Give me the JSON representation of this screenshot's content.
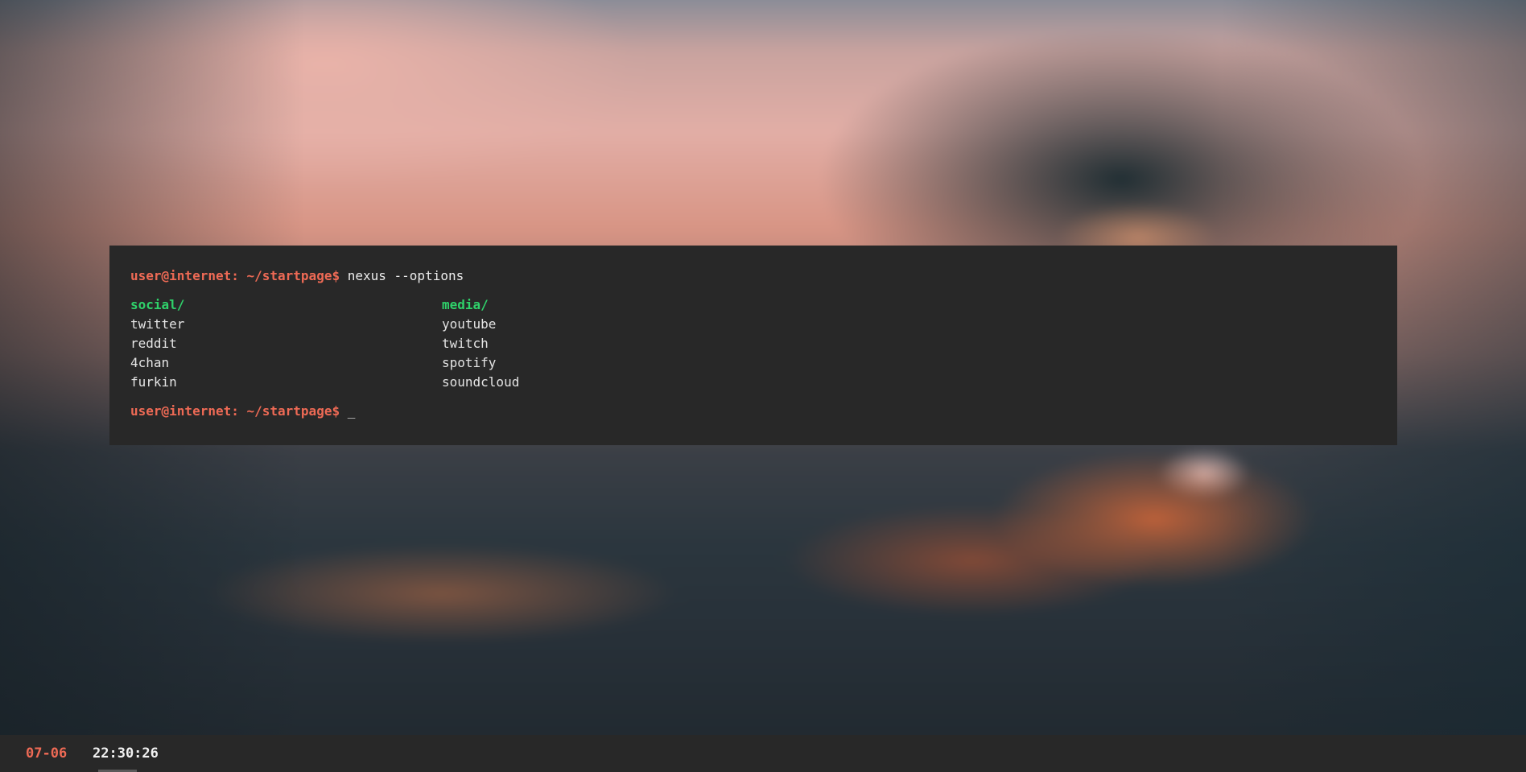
{
  "background": {
    "description_colors": {
      "sky_top": "#c9a39f",
      "sky_glow": "#e2aea6",
      "street_dark": "#273038",
      "light_glow": "#eb6e37"
    }
  },
  "terminal": {
    "prompt": "user@internet: ~/startpage$",
    "command": "nexus --options",
    "cursor": "_",
    "columns": [
      {
        "heading": "social/",
        "links": [
          "twitter",
          "reddit",
          "4chan",
          "furkin"
        ]
      },
      {
        "heading": "media/",
        "links": [
          "youtube",
          "twitch",
          "spotify",
          "soundcloud"
        ]
      }
    ],
    "colors": {
      "background": "#282828",
      "prompt": "#ee6a55",
      "directory": "#2fd16a",
      "text": "#e4e4e4"
    }
  },
  "statusbar": {
    "date": "07-06",
    "time": "22:30:26",
    "colors": {
      "date": "#ee6a55",
      "time": "#f2f2f2"
    }
  }
}
